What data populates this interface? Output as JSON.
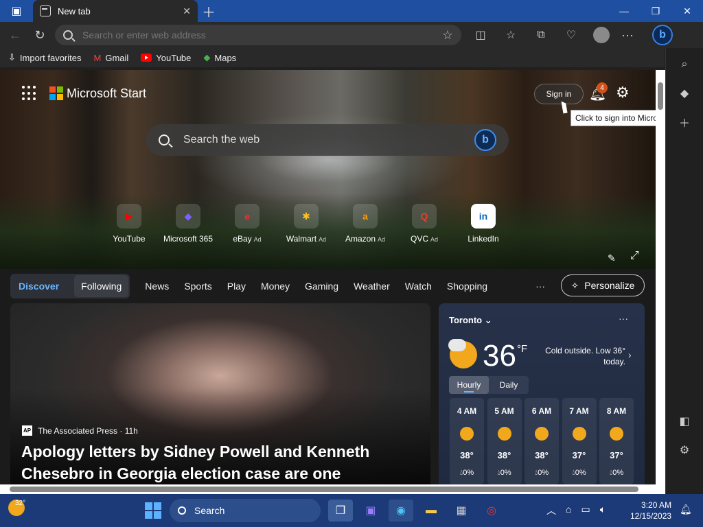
{
  "browser": {
    "tab_title": "New tab",
    "address_placeholder": "Search or enter web address"
  },
  "favorites": [
    {
      "label": "Import favorites",
      "icon": "import-icon"
    },
    {
      "label": "Gmail",
      "icon": "gmail-icon"
    },
    {
      "label": "YouTube",
      "icon": "youtube-icon"
    },
    {
      "label": "Maps",
      "icon": "maps-icon"
    }
  ],
  "header": {
    "brand": "Microsoft Start",
    "signin_label": "Sign in",
    "notification_count": "4",
    "tooltip": "Click to sign into Microsoft Edge"
  },
  "search": {
    "placeholder": "Search the web"
  },
  "quicklinks": [
    {
      "label": "YouTube",
      "ad": "",
      "glyph": "▶",
      "color": "#ff0000"
    },
    {
      "label": "Microsoft 365",
      "ad": "",
      "glyph": "◆",
      "color": "#7b61ff"
    },
    {
      "label": "eBay",
      "ad": "Ad",
      "glyph": "e",
      "color": "#e53238"
    },
    {
      "label": "Walmart",
      "ad": "Ad",
      "glyph": "✱",
      "color": "#ffc220"
    },
    {
      "label": "Amazon",
      "ad": "Ad",
      "glyph": "a",
      "color": "#ff9900"
    },
    {
      "label": "QVC",
      "ad": "Ad",
      "glyph": "Q",
      "color": "#e04030"
    },
    {
      "label": "LinkedIn",
      "ad": "",
      "glyph": "in",
      "color": "#0a66c2"
    }
  ],
  "nav": {
    "discover": "Discover",
    "following": "Following",
    "items": [
      "News",
      "Sports",
      "Play",
      "Money",
      "Gaming",
      "Weather",
      "Watch",
      "Shopping"
    ],
    "more": "···",
    "personalize": "Personalize"
  },
  "news": {
    "source": "The Associated Press · 11h",
    "source_logo": "AP",
    "headline": "Apology letters by Sidney Powell and Kenneth Chesebro in Georgia election case are one sentence..."
  },
  "weather": {
    "city": "Toronto",
    "temp": "36",
    "unit": "°F",
    "note": "Cold outside. Low 36° today.",
    "tabs": [
      "Hourly",
      "Daily"
    ],
    "hours": [
      {
        "time": "4 AM",
        "temp": "38°",
        "precip": "0%"
      },
      {
        "time": "5 AM",
        "temp": "38°",
        "precip": "0%"
      },
      {
        "time": "6 AM",
        "temp": "38°",
        "precip": "0%"
      },
      {
        "time": "7 AM",
        "temp": "37°",
        "precip": "0%"
      },
      {
        "time": "8 AM",
        "temp": "37°",
        "precip": "0%"
      }
    ]
  },
  "taskbar": {
    "weather_temp": "32°",
    "search_label": "Search",
    "time": "3:20 AM",
    "date": "12/15/2023"
  }
}
